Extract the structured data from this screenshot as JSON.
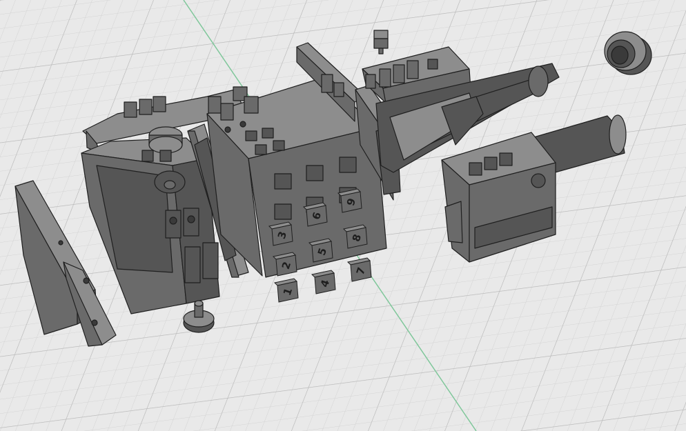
{
  "viewport": {
    "background_color": "#e9e9e9",
    "grid_minor_color": "#d2d2d2",
    "grid_major_color": "#b9b9b9",
    "axis_color": "#7fc79a"
  },
  "model": {
    "part_color_top": "#8d8d8d",
    "part_color_front": "#6a6a6a",
    "part_color_side": "#555555",
    "edge_color": "#1f1f1f",
    "keypad": {
      "keys": [
        {
          "label": "1"
        },
        {
          "label": "2"
        },
        {
          "label": "3"
        },
        {
          "label": "4"
        },
        {
          "label": "5"
        },
        {
          "label": "6"
        },
        {
          "label": "7"
        },
        {
          "label": "8"
        },
        {
          "label": "9"
        }
      ]
    }
  }
}
